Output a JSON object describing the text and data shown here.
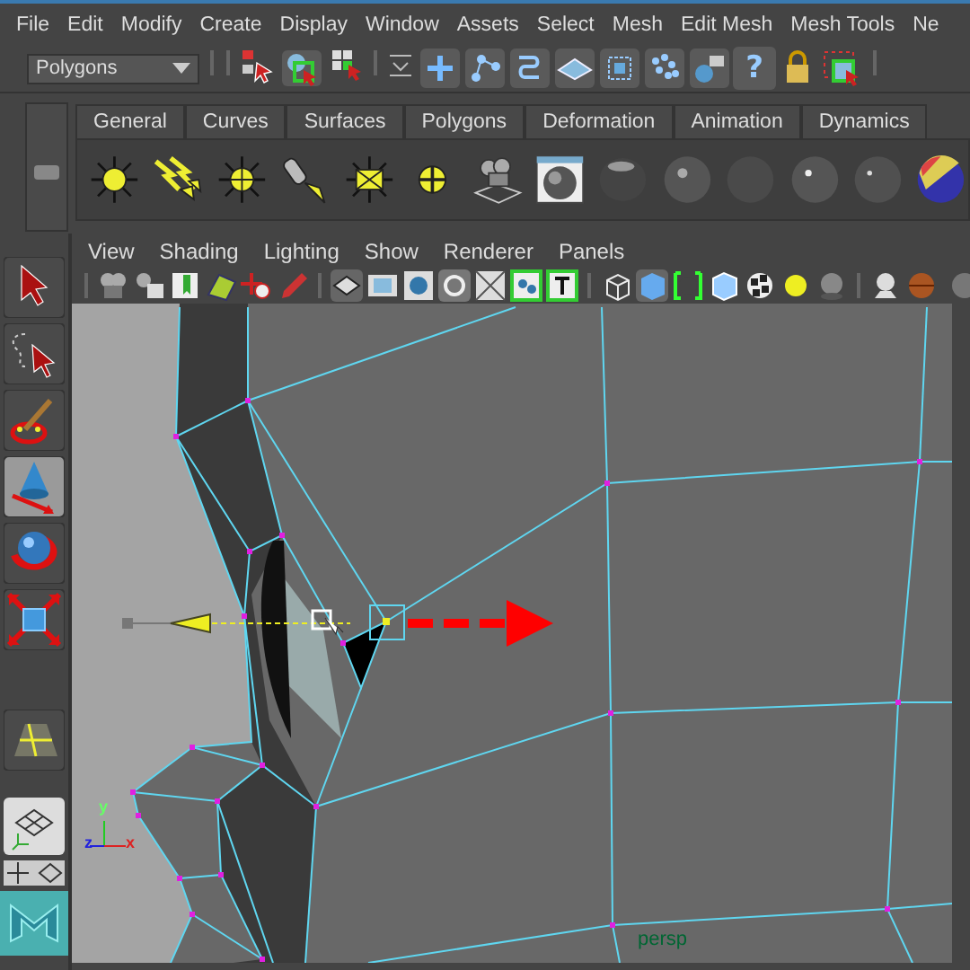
{
  "menu_bar": {
    "items": [
      "File",
      "Edit",
      "Modify",
      "Create",
      "Display",
      "Window",
      "Assets",
      "Select",
      "Mesh",
      "Edit Mesh",
      "Mesh Tools",
      "Ne"
    ]
  },
  "status_line": {
    "mode_dropdown": "Polygons",
    "help_button": "?"
  },
  "shelf": {
    "tabs": [
      "General",
      "Curves",
      "Surfaces",
      "Polygons",
      "Deformation",
      "Animation",
      "Dynamics"
    ]
  },
  "toolbox": {
    "tools": [
      {
        "selected": false
      },
      {
        "selected": false
      },
      {
        "selected": false
      },
      {
        "selected": true
      },
      {
        "selected": false
      },
      {
        "selected": false
      }
    ]
  },
  "panel": {
    "menu_items": [
      "View",
      "Shading",
      "Lighting",
      "Show",
      "Renderer",
      "Panels"
    ],
    "viewport": {
      "camera_label": "persp",
      "axis_labels": [
        "x",
        "y",
        "z"
      ]
    }
  }
}
